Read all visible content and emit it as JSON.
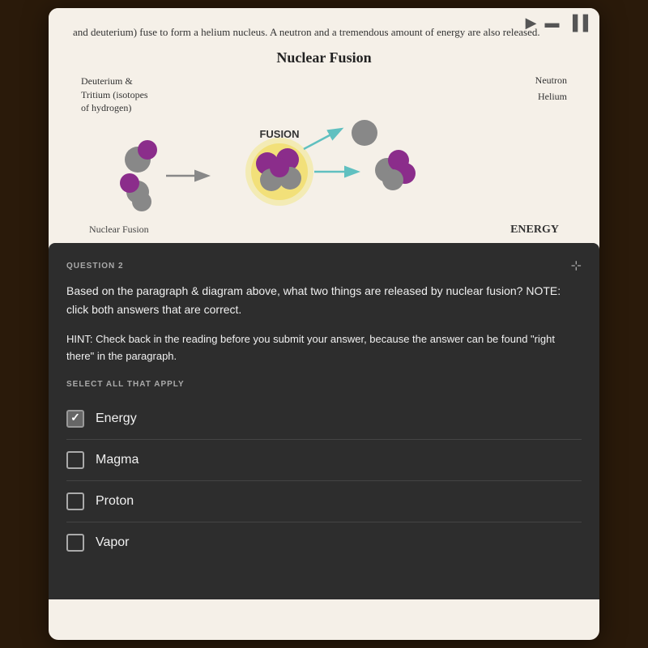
{
  "topbar": {
    "play_icon": "▶",
    "note_icon": "▬",
    "chart_icon": "▐▐"
  },
  "reading": {
    "text": "and deuterium) fuse to form a helium nucleus. A neutron and a tremendous amount of energy are also released."
  },
  "diagram": {
    "title": "Nuclear Fusion",
    "label_left_line1": "Deuterium &",
    "label_left_line2": "Tritium (isotopes",
    "label_left_line3": "of hydrogen)",
    "fusion_label": "FUSION",
    "neutron_label": "Neutron",
    "helium_label": "Helium",
    "caption_left": "Nuclear Fusion",
    "caption_right": "ENERGY"
  },
  "question": {
    "label": "QUESTION 2",
    "pin_icon": "⊹",
    "text": "Based on the paragraph & diagram above, what two things are released by nuclear fusion? NOTE: click both answers that are correct.",
    "hint": "HINT: Check back in the reading before you submit your answer, because the answer can be found \"right there\" in the paragraph.",
    "select_label": "SELECT ALL THAT APPLY",
    "options": [
      {
        "id": "energy",
        "label": "Energy",
        "checked": true
      },
      {
        "id": "magma",
        "label": "Magma",
        "checked": false
      },
      {
        "id": "proton",
        "label": "Proton",
        "checked": false
      },
      {
        "id": "vapor",
        "label": "Vapor",
        "checked": false
      }
    ]
  }
}
